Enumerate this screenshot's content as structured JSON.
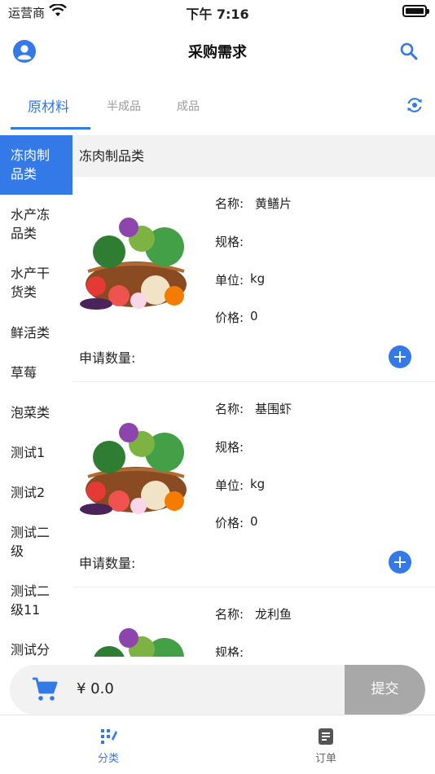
{
  "status_bar": {
    "carrier": "运营商",
    "time": "下午 7:16"
  },
  "nav": {
    "title": "采购需求",
    "left_icon": "user-icon",
    "right_icon": "search-icon"
  },
  "tabs": [
    {
      "label": "原材料",
      "active": true
    },
    {
      "label": "半成品",
      "active": false
    },
    {
      "label": "成品",
      "active": false
    }
  ],
  "tabs_icon": "refresh-icon",
  "sidebar": [
    {
      "label": "冻肉制品类",
      "active": true
    },
    {
      "label": "水产冻品类"
    },
    {
      "label": "水产干货类"
    },
    {
      "label": "鲜活类"
    },
    {
      "label": "草莓"
    },
    {
      "label": "泡菜类"
    },
    {
      "label": "测试1"
    },
    {
      "label": "测试2"
    },
    {
      "label": "测试二级"
    },
    {
      "label": "测试二级11"
    },
    {
      "label": "测试分"
    }
  ],
  "category_header": "冻肉制品类",
  "labels": {
    "name": "名称:",
    "spec": "规格:",
    "unit": "单位:",
    "price": "价格:",
    "request_qty": "申请数量:"
  },
  "products": [
    {
      "name": "黄鳝片",
      "spec": "",
      "unit": "kg",
      "price": "0"
    },
    {
      "name": "基围虾",
      "spec": "",
      "unit": "kg",
      "price": "0"
    },
    {
      "name": "龙利鱼",
      "spec": "",
      "unit": "",
      "price": ""
    }
  ],
  "cart": {
    "price": "¥ 0.0",
    "submit_label": "提交",
    "icon": "cart-icon"
  },
  "tabbar": [
    {
      "label": "分类",
      "active": true,
      "icon": "category-icon"
    },
    {
      "label": "订单",
      "active": false,
      "icon": "order-icon"
    }
  ],
  "colors": {
    "accent": "#3479e8",
    "submit_disabled": "#a8a8a8",
    "header_bg": "#f2f2f2"
  }
}
